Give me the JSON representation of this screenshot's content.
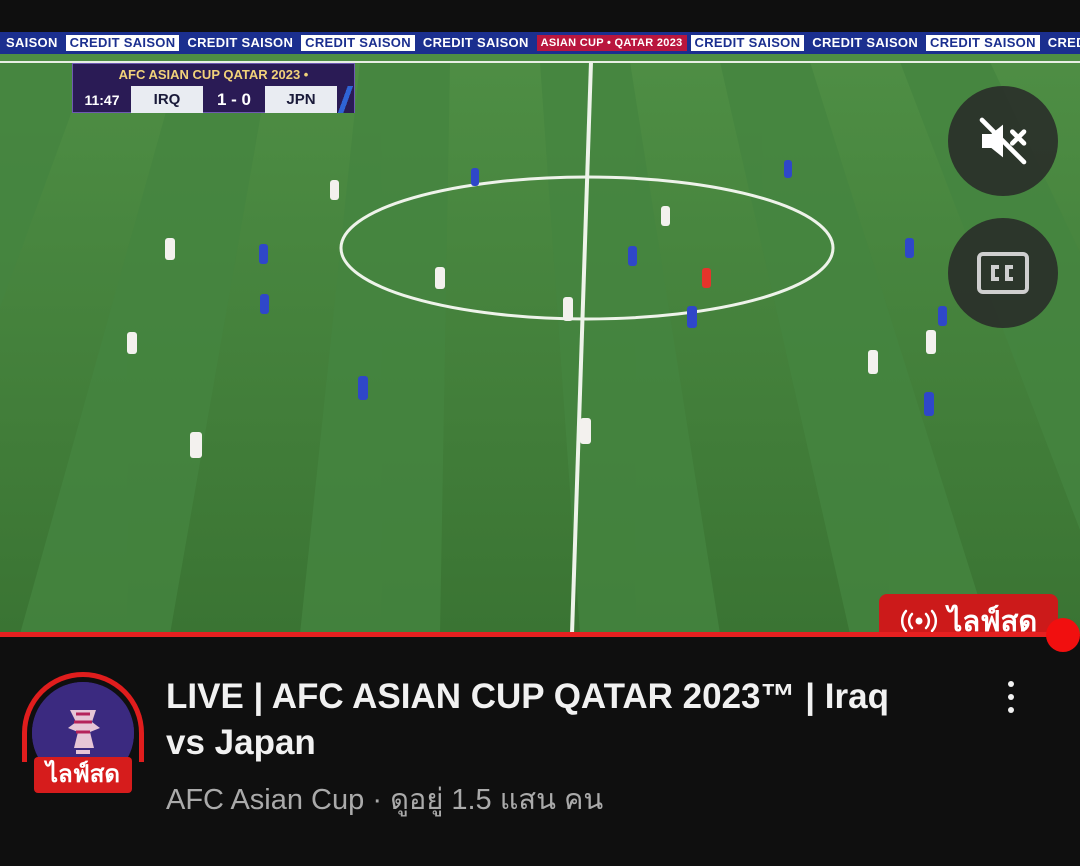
{
  "ad_board": {
    "items": [
      "SAISON",
      "CREDIT SAISON",
      "CREDIT SAISON",
      "CREDIT SAISON",
      "CREDIT SAISON",
      "ASIAN CUP • QATAR 2023",
      "CREDIT SAISON",
      "CREDIT SAISON",
      "CREDIT SAISON",
      "CREDIT"
    ]
  },
  "scorebug": {
    "title": "AFC ASIAN CUP QATAR 2023 •",
    "clock": "11:47",
    "home": "IRQ",
    "score": "1 - 0",
    "away": "JPN"
  },
  "player_controls": {
    "mute_icon": "volume-muted-icon",
    "cc_icon": "closed-captions-icon",
    "live_label": "ไลฟ์สด",
    "live_icon": "broadcast-icon",
    "progress_fraction": 1.0
  },
  "video_info": {
    "title": "LIVE | AFC ASIAN CUP QATAR 2023™ | Iraq vs Japan",
    "channel": "AFC Asian Cup",
    "separator": "·",
    "viewers": "ดูอยู่ 1.5 แสน คน",
    "avatar_live_label": "ไลฟ์สด",
    "more_icon": "more-vertical-icon"
  },
  "colors": {
    "live_red": "#cc1a1a",
    "progress_red": "#e52020",
    "pitch_green": "#3f7c3a",
    "scorebug_purple": "#2a1b55"
  }
}
